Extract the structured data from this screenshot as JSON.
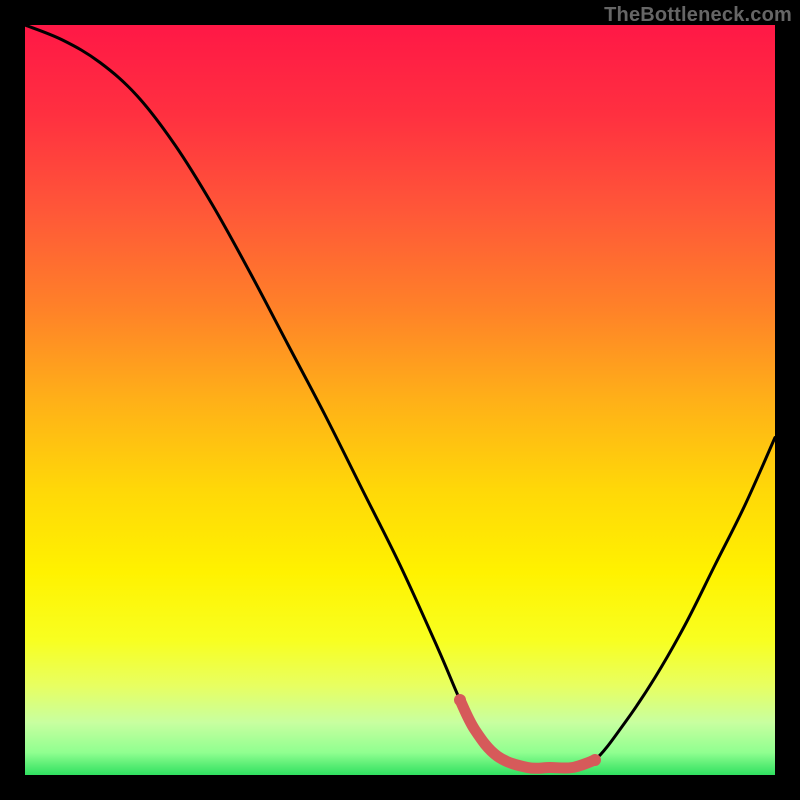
{
  "attribution": "TheBottleneck.com",
  "chart_data": {
    "type": "line",
    "title": "",
    "xlabel": "",
    "ylabel": "",
    "xlim": [
      0,
      100
    ],
    "ylim": [
      0,
      100
    ],
    "series": [
      {
        "name": "bottleneck-curve",
        "x": [
          0,
          5,
          10,
          15,
          20,
          25,
          30,
          35,
          40,
          45,
          50,
          55,
          58,
          60,
          63,
          67,
          70,
          73,
          76,
          80,
          84,
          88,
          92,
          96,
          100
        ],
        "values": [
          100,
          98,
          95,
          90.5,
          84,
          76,
          67,
          57.5,
          48,
          38,
          28,
          17,
          10,
          6,
          2.5,
          1,
          1,
          1,
          2,
          7,
          13,
          20,
          28,
          36,
          45
        ]
      },
      {
        "name": "highlight-segment",
        "x": [
          58,
          60,
          63,
          67,
          70,
          73,
          76
        ],
        "values": [
          10,
          6,
          2.5,
          1,
          1,
          1,
          2
        ]
      }
    ],
    "gradient_stops": [
      {
        "offset": 0.0,
        "color": "#ff1846"
      },
      {
        "offset": 0.12,
        "color": "#ff3040"
      },
      {
        "offset": 0.25,
        "color": "#ff5838"
      },
      {
        "offset": 0.38,
        "color": "#ff8228"
      },
      {
        "offset": 0.5,
        "color": "#ffb018"
      },
      {
        "offset": 0.62,
        "color": "#ffd808"
      },
      {
        "offset": 0.73,
        "color": "#fff200"
      },
      {
        "offset": 0.82,
        "color": "#f8ff20"
      },
      {
        "offset": 0.88,
        "color": "#e8ff60"
      },
      {
        "offset": 0.93,
        "color": "#c8ffa0"
      },
      {
        "offset": 0.97,
        "color": "#90ff90"
      },
      {
        "offset": 1.0,
        "color": "#30e060"
      }
    ],
    "highlight_color": "#d65a5a",
    "curve_color": "#000000"
  }
}
